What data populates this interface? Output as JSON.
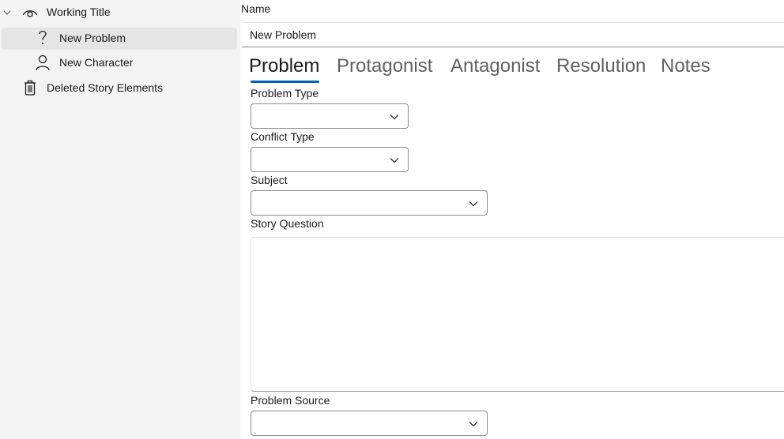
{
  "sidebar": {
    "items": [
      {
        "label": "Working Title",
        "icon": "eye-icon",
        "expanded": true
      },
      {
        "label": "New Problem",
        "icon": "question-icon",
        "selected": true
      },
      {
        "label": "New Character",
        "icon": "person-icon"
      },
      {
        "label": "Deleted Story Elements",
        "icon": "trash-icon"
      }
    ]
  },
  "main": {
    "name_label": "Name",
    "name_value": "New Problem",
    "tabs": [
      {
        "label": "Problem",
        "active": true
      },
      {
        "label": "Protagonist"
      },
      {
        "label": "Antagonist"
      },
      {
        "label": "Resolution"
      },
      {
        "label": "Notes"
      }
    ],
    "fields": {
      "problem_type_label": "Problem Type",
      "conflict_type_label": "Conflict Type",
      "subject_label": "Subject",
      "story_question_label": "Story Question",
      "problem_source_label": "Problem Source"
    }
  },
  "colors": {
    "accent": "#005fb8",
    "sidebar_bg": "#f3f3f3",
    "selected_bg": "#e5e5e5"
  }
}
